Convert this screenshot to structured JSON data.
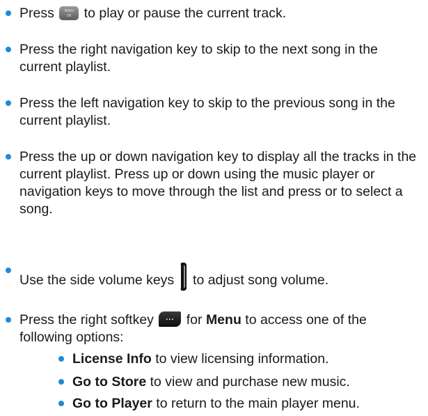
{
  "bullet_color": "#1f8ad6",
  "items": [
    {
      "before": "Press ",
      "icon": "menu-ok-key-icon",
      "after": " to play or pause the current track."
    },
    {
      "text": "Press the right navigation key to skip to the next song in the current playlist."
    },
    {
      "text": "Press the left navigation key to skip to the previous song in the current playlist."
    },
    {
      "text": "Press the up or down navigation key to display all the tracks in the current playlist. Press up or down using the music player or navigation keys to move through the list and press or to select a song."
    },
    {
      "before": "Use the side volume keys ",
      "icon": "side-volume-key-icon",
      "after": " to adjust song volume."
    },
    {
      "before": "Press the right softkey ",
      "icon": "right-softkey-icon",
      "mid": " for ",
      "bold": "Menu",
      "after": " to access one of the following options:"
    }
  ],
  "icon_labels": {
    "menu_ok_top": "MENU",
    "menu_ok_bottom": "OK",
    "softkey": "..."
  },
  "sub_items": [
    {
      "bold": "License Info",
      "text": " to view licensing information."
    },
    {
      "bold": "Go to Store",
      "text": " to view and purchase new music."
    },
    {
      "bold": "Go to Player",
      "text": " to return to the main player menu."
    }
  ]
}
